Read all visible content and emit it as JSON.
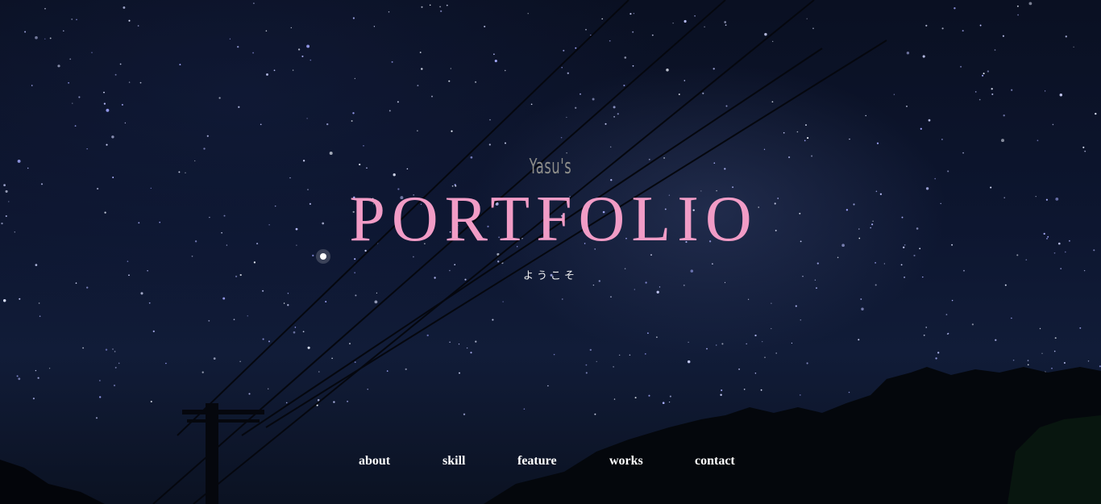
{
  "hero": {
    "subtitle": "Yasu's",
    "title": "PORTFOLIO",
    "welcome": "ようこそ"
  },
  "nav": {
    "items": [
      {
        "label": "about"
      },
      {
        "label": "skill"
      },
      {
        "label": "feature"
      },
      {
        "label": "works"
      },
      {
        "label": "contact"
      }
    ]
  },
  "colors": {
    "title": "#f19cc6",
    "subtitle": "#8e8e8a",
    "nav_text": "#ffffff",
    "sky": "#0b1121"
  }
}
